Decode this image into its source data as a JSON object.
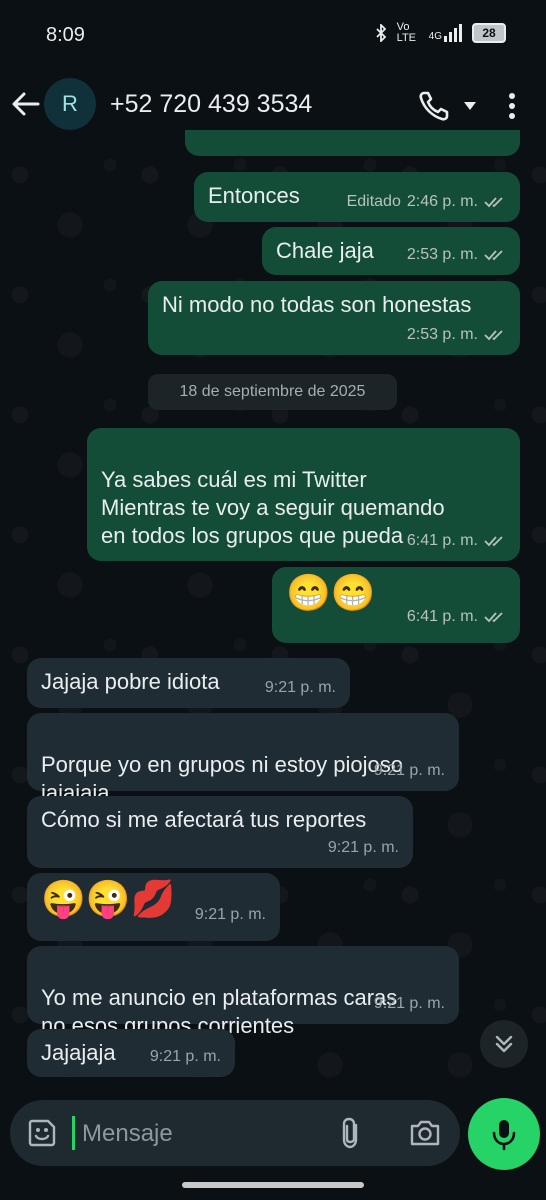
{
  "status": {
    "time": "8:09",
    "network": "Vo LTE",
    "signal": "4G",
    "battery": "28"
  },
  "header": {
    "avatar_letter": "R",
    "contact": "+52 720 439 3534"
  },
  "messages": [
    {
      "dir": "out",
      "text": "Entonces",
      "edited": "Editado",
      "time": "2:46 p. m."
    },
    {
      "dir": "out",
      "text": "Chale jaja",
      "time": "2:53 p. m."
    },
    {
      "dir": "out",
      "text": "Ni modo no todas son honestas",
      "time": "2:53 p. m."
    },
    {
      "dir": "out",
      "text": "Ya sabes cuál es mi Twitter\nMientras te voy a seguir quemando\nen todos los grupos que pueda",
      "time": "6:41 p. m."
    },
    {
      "dir": "out",
      "text": "😁😁",
      "time": "6:41 p. m."
    },
    {
      "dir": "in",
      "text": "Jajaja pobre idiota",
      "time": "9:21 p. m."
    },
    {
      "dir": "in",
      "text": "Porque yo en grupos ni estoy piojoso\njajajaja",
      "time": "9:21 p. m."
    },
    {
      "dir": "in",
      "text": "Cómo si me afectará tus reportes",
      "time": "9:21 p. m."
    },
    {
      "dir": "in",
      "text": "😜😜💋",
      "time": "9:21 p. m."
    },
    {
      "dir": "in",
      "text": "Yo me anuncio en plataformas caras\nno esos grupos corrientes",
      "time": "9:21 p. m."
    },
    {
      "dir": "in",
      "text": "Jajajaja",
      "time": "9:21 p. m."
    }
  ],
  "date_divider": "18 de septiembre de 2025",
  "composer": {
    "placeholder": "Mensaje"
  },
  "icons": {
    "back": "arrow-left-icon",
    "call": "phone-icon",
    "menu": "more-vertical-icon",
    "sticker": "sticker-icon",
    "attach": "paperclip-icon",
    "camera": "camera-icon",
    "mic": "microphone-icon",
    "scroll": "double-chevron-down-icon"
  },
  "colors": {
    "outgoing_bubble": "#134d37",
    "incoming_bubble": "#202c33",
    "accent": "#25d366"
  }
}
